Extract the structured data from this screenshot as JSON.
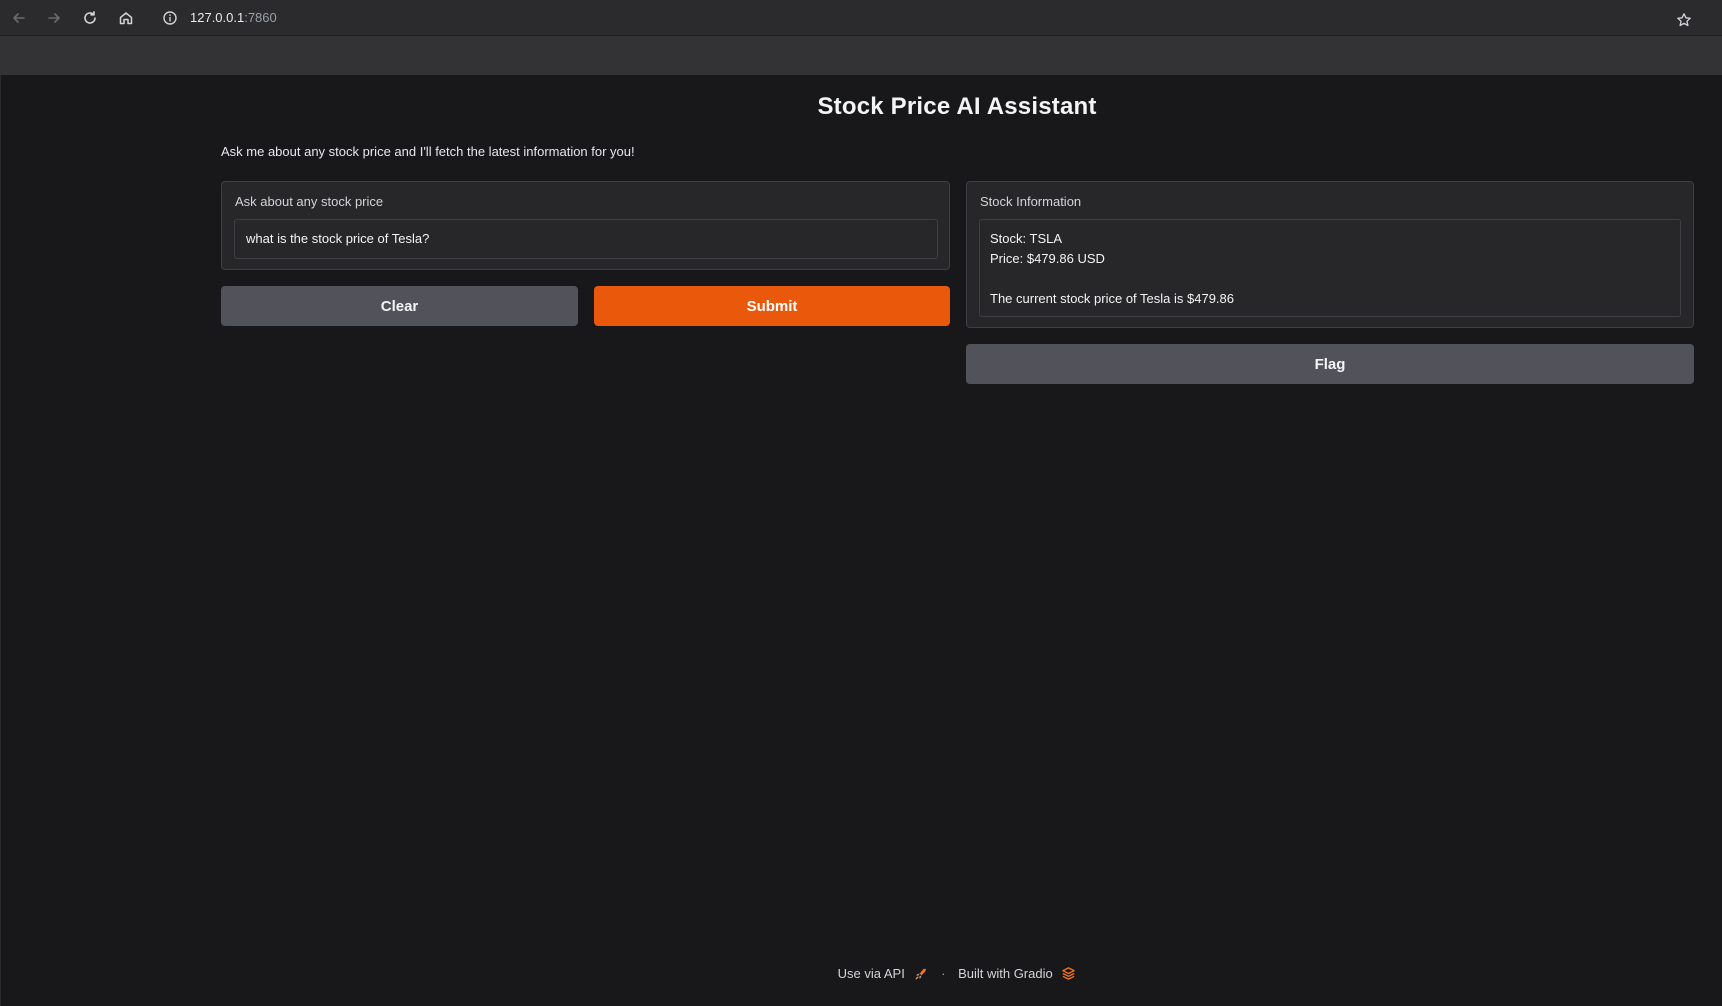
{
  "browser": {
    "url_host": "127.0.0.1",
    "url_port": ":7860"
  },
  "page": {
    "title": "Stock Price AI Assistant",
    "subtitle": "Ask me about any stock price and I'll fetch the latest information for you!"
  },
  "input_panel": {
    "label": "Ask about any stock price",
    "value": "what is the stock price of Tesla?"
  },
  "output_panel": {
    "label": "Stock Information",
    "lines": [
      "Stock: TSLA",
      "Price: $479.86 USD",
      "",
      "The current stock price of Tesla is $479.86"
    ]
  },
  "buttons": {
    "clear_label": "Clear",
    "submit_label": "Submit",
    "flag_label": "Flag"
  },
  "footer": {
    "api_label": "Use via API",
    "separator": "·",
    "built_label": "Built with Gradio"
  },
  "colors": {
    "background": "#18181b",
    "panel": "#27272a",
    "primary": "#ea580c",
    "secondary": "#52525b"
  },
  "icons": {
    "back": "arrow-left-icon",
    "forward": "arrow-right-icon",
    "reload": "reload-icon",
    "home": "home-icon",
    "info": "info-icon",
    "star": "star-icon",
    "rocket": "rocket-icon",
    "gradio": "gradio-logo-icon"
  }
}
